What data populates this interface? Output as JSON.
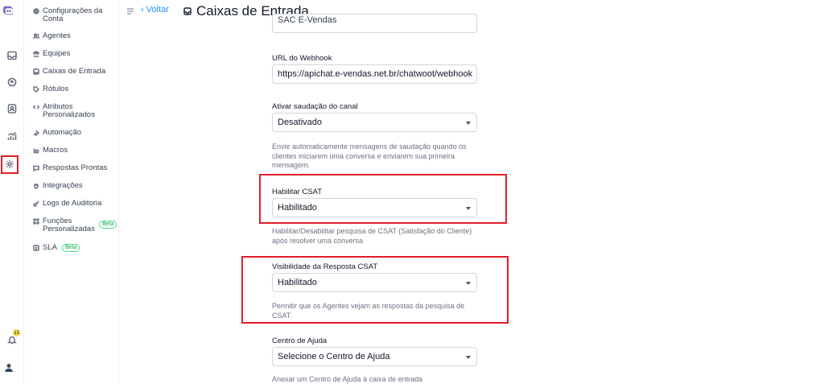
{
  "header": {
    "back_label": "Voltar",
    "title": "Caixas de Entrada"
  },
  "rail": {
    "notification_count": "13",
    "icons": [
      "logo-icon",
      "inbox-icon",
      "conversations-icon",
      "contacts-icon",
      "reports-icon",
      "settings-icon",
      "bell-icon"
    ]
  },
  "sidebar": {
    "items": [
      {
        "label": "Configurações da Conta",
        "icon": "settings-icon"
      },
      {
        "label": "Agentes",
        "icon": "agents-icon"
      },
      {
        "label": "Equipes",
        "icon": "teams-icon"
      },
      {
        "label": "Caixas de Entrada",
        "icon": "inbox-icon"
      },
      {
        "label": "Rótulos",
        "icon": "tag-icon"
      },
      {
        "label": "Atributos Personalizados",
        "icon": "code-icon"
      },
      {
        "label": "Automação",
        "icon": "automation-icon"
      },
      {
        "label": "Macros",
        "icon": "macros-icon"
      },
      {
        "label": "Respostas Prontas",
        "icon": "chat-icon"
      },
      {
        "label": "Integrações",
        "icon": "plug-icon"
      },
      {
        "label": "Logs de Auditoria",
        "icon": "key-icon"
      },
      {
        "label": "Funções Personalizadas",
        "icon": "roles-icon",
        "badge": "Beta"
      },
      {
        "label": "SLA",
        "icon": "sla-icon",
        "badge": "Beta"
      }
    ]
  },
  "form": {
    "partial_top_value": "SAC E-Vendas",
    "webhook": {
      "label": "URL do Webhook",
      "value": "https://apichat.e-vendas.net.br/chatwoot/webhook"
    },
    "greeting": {
      "label": "Ativar saudação do canal",
      "value": "Desativado",
      "help": "Envie automaticamente mensagens de saudação quando os clientes iniciarem uma conversa e enviarem sua primeira mensagem."
    },
    "csat": {
      "label": "Habilitar CSAT",
      "value": "Habilitado",
      "help": "Habilitar/Desabilitar pesquisa de CSAT (Satisfação do Cliente) após resolver uma conversa"
    },
    "csat_visibility": {
      "label": "Visibilidade da Resposta CSAT",
      "value": "Habilitado",
      "help": "Permitir que os Agentes vejam as respostas da pesquisa de CSAT"
    },
    "help_center": {
      "label": "Centro de Ajuda",
      "value": "Selecione o Centro de Ajuda",
      "help": "Anexar um Centro de Ajuda à caixa de entrada"
    }
  },
  "colors": {
    "accent": "#1f93ff",
    "highlight": "#e11d2a",
    "beta": "#16a34a"
  }
}
